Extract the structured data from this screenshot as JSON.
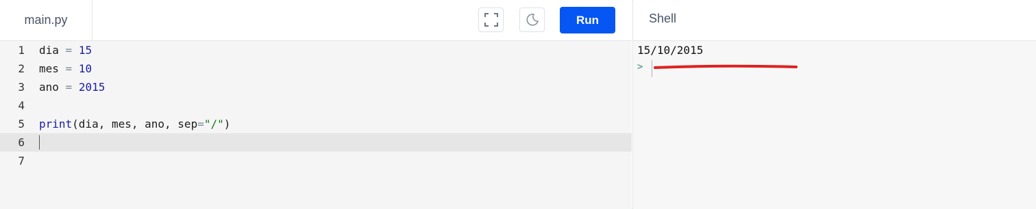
{
  "editor": {
    "file_tab": "main.py",
    "run_label": "Run",
    "lines": [
      {
        "number": "1",
        "tokens": [
          {
            "t": "dia ",
            "c": ""
          },
          {
            "t": "=",
            "c": "op"
          },
          {
            "t": " ",
            "c": ""
          },
          {
            "t": "15",
            "c": "num"
          }
        ]
      },
      {
        "number": "2",
        "tokens": [
          {
            "t": "mes ",
            "c": ""
          },
          {
            "t": "=",
            "c": "op"
          },
          {
            "t": " ",
            "c": ""
          },
          {
            "t": "10",
            "c": "num"
          }
        ]
      },
      {
        "number": "3",
        "tokens": [
          {
            "t": "ano ",
            "c": ""
          },
          {
            "t": "=",
            "c": "op"
          },
          {
            "t": " ",
            "c": ""
          },
          {
            "t": "2015",
            "c": "num"
          }
        ]
      },
      {
        "number": "4",
        "tokens": []
      },
      {
        "number": "5",
        "tokens": [
          {
            "t": "print",
            "c": "kw"
          },
          {
            "t": "(dia, mes, ano, sep",
            "c": ""
          },
          {
            "t": "=",
            "c": "op"
          },
          {
            "t": "\"/\"",
            "c": "str"
          },
          {
            "t": ")",
            "c": ""
          }
        ]
      },
      {
        "number": "6",
        "tokens": [],
        "active": true
      },
      {
        "number": "7",
        "tokens": []
      }
    ]
  },
  "shell": {
    "title": "Shell",
    "output": "15/10/2015",
    "prompt": ">"
  },
  "icons": {
    "fullscreen": "fullscreen-icon",
    "theme": "moon-icon"
  },
  "colors": {
    "run_button": "#0556f3",
    "annotation": "#e02020"
  }
}
